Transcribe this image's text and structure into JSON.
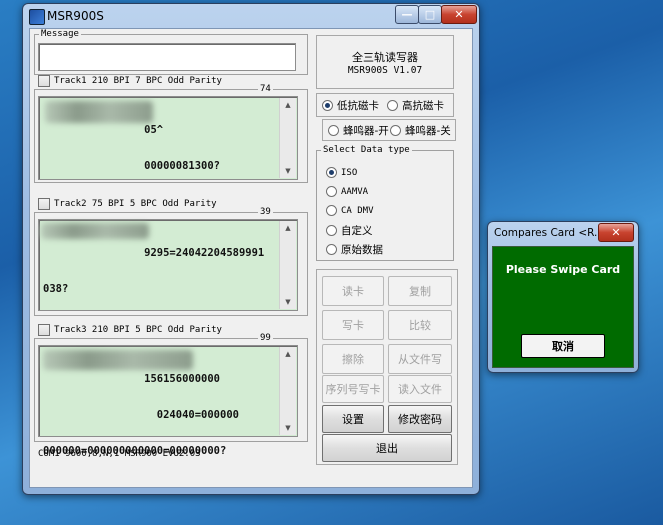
{
  "main_window": {
    "title": "MSR900S",
    "controls": {
      "minimize": "—",
      "maximize": "□",
      "close": "✕"
    },
    "message_label": "Message",
    "message_value": "",
    "info": {
      "line1": "全三轨读写器",
      "line2": "MSR900S  V1.07"
    },
    "tracks": [
      {
        "label": "Track1 210 BPI 7 BPC Odd Parity",
        "count": "74",
        "lines": [
          "                05^",
          "                00000081300?"
        ]
      },
      {
        "label": "Track2 75 BPI 5 BPC Odd Parity",
        "count": "39",
        "lines": [
          "                9295=24042204589991",
          "038?"
        ]
      },
      {
        "label": "Track3 210 BPI 5 BPC Odd Parity",
        "count": "99",
        "lines": [
          "                156156000000",
          "                  024040=000000",
          "000000=000000000000=00000000?"
        ]
      }
    ],
    "coercivity": {
      "low": "低抗磁卡",
      "high": "高抗磁卡",
      "selected": "low"
    },
    "buzzer": {
      "on": "蜂鸣器-开",
      "off": "蜂鸣器-关",
      "selected": "none"
    },
    "data_type": {
      "legend": "Select Data type",
      "options": [
        "ISO",
        "AAMVA",
        "CA DMV",
        "自定义",
        "原始数据"
      ],
      "selected": 0
    },
    "buttons": {
      "read": "读卡",
      "copy": "复制",
      "write": "写卡",
      "compare": "比较",
      "erase": "擦除",
      "from_file": "从文件写",
      "serial_write": "序列号写卡",
      "read_file": "读入文件",
      "settings": "设置",
      "change_password": "修改密码",
      "exit": "退出"
    },
    "status_bar": "COM1 9600,8,N,1  MSR900 EVU2.03"
  },
  "dialog": {
    "title": "Compares Card <R...",
    "close": "✕",
    "prompt": "Please Swipe Card",
    "cancel": "取消",
    "background_color": "#006b00"
  }
}
